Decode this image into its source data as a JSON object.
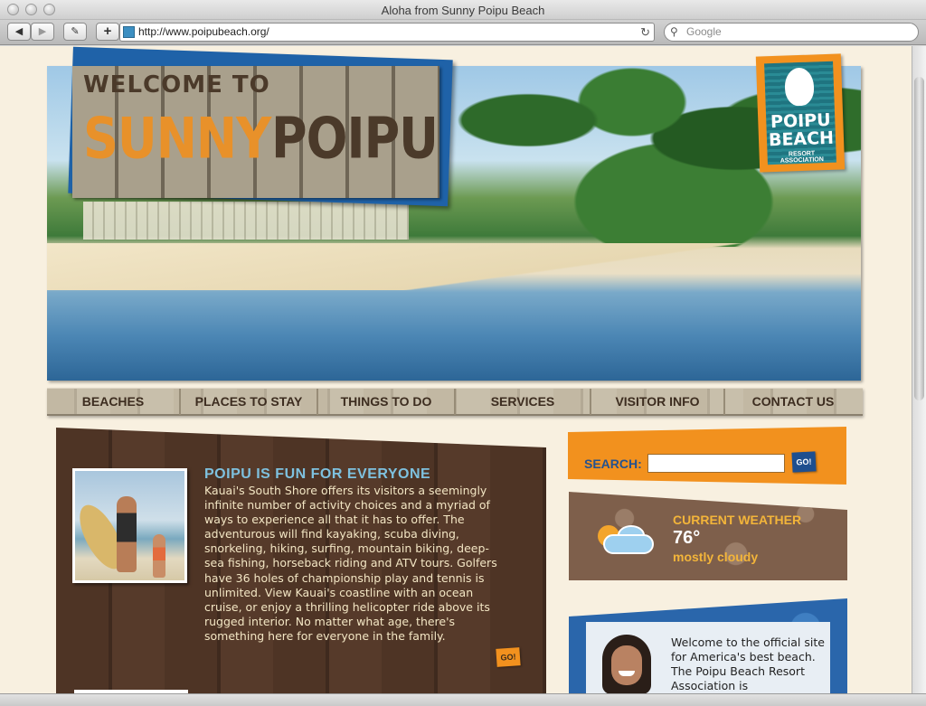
{
  "window": {
    "title": "Aloha from Sunny Poipu Beach"
  },
  "toolbar": {
    "back_icon": "back-arrow-icon",
    "forward_icon": "forward-arrow-icon",
    "add_bookmark_label": "+",
    "url": "http://www.poipubeach.org/",
    "search_placeholder": "Google"
  },
  "hero": {
    "welcome_to": "WELCOME TO",
    "sunny": "SUNNY",
    "poipu": "POIPU",
    "logo_line1": "POIPU",
    "logo_line2": "BEACH",
    "logo_sub": "RESORT ASSOCIATION"
  },
  "nav": {
    "items": [
      {
        "label": "BEACHES"
      },
      {
        "label": "PLACES TO STAY"
      },
      {
        "label": "THINGS TO DO"
      },
      {
        "label": "SERVICES"
      },
      {
        "label": "VISITOR INFO"
      },
      {
        "label": "CONTACT US"
      }
    ]
  },
  "story": {
    "title": "POIPU IS FUN FOR EVERYONE",
    "body": "Kauai's South Shore offers its visitors a seemingly infinite number of activity choices and a myriad of ways to experience all that it has to offer. The adventurous will find kayaking, scuba diving, snorkeling, hiking, surfing, mountain biking, deep-sea fishing, horseback riding and ATV tours. Golfers have 36 holes of championship play and tennis is unlimited. View Kauai's coastline with an ocean cruise, or enjoy a thrilling helicopter ride above its rugged interior. No matter what age, there's something here for everyone in the family.",
    "go_label": "GO!"
  },
  "search": {
    "label": "SEARCH:",
    "value": "",
    "go_label": "GO!"
  },
  "weather": {
    "title": "CURRENT WEATHER",
    "temp": "76°",
    "condition": "mostly cloudy",
    "icon": "partly-cloudy-icon"
  },
  "welcome": {
    "text": "Welcome to the official site for America's best beach. The Poipu Beach Resort Association is"
  },
  "colors": {
    "accent_orange": "#f2911e",
    "nav_text": "#3d2d20",
    "story_title": "#7ec1df",
    "weather_title": "#f3b53a",
    "brand_blue": "#24528f"
  }
}
